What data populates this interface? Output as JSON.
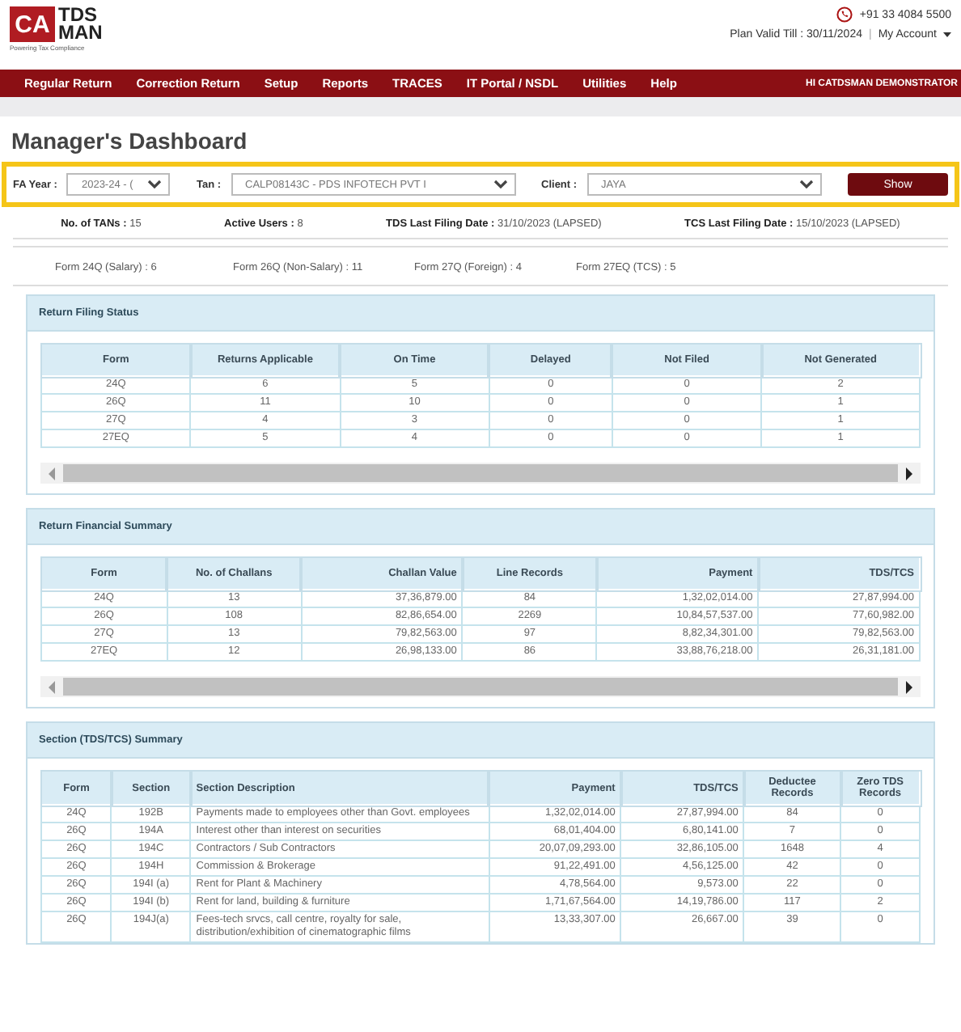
{
  "logo": {
    "mark": "CA",
    "line_1": "TDS",
    "line_2": "MAN",
    "tagline": "Powering Tax Compliance"
  },
  "header": {
    "phone": "+91 33 4084 5500",
    "plan_valid": "Plan Valid Till : 30/11/2024",
    "separator": "|",
    "account": "My Account"
  },
  "nav": {
    "items": [
      "Regular Return",
      "Correction Return",
      "Setup",
      "Reports",
      "TRACES",
      "IT Portal / NSDL",
      "Utilities",
      "Help"
    ],
    "user": "HI CATDSMAN DEMONSTRATOR"
  },
  "title": "Manager's Dashboard",
  "filters": [
    {
      "label": "FA Year :",
      "value": "2023-24 - ("
    },
    {
      "label": "Tan :",
      "value": "CALP08143C - PDS INFOTECH PVT I"
    },
    {
      "label": "Client :",
      "value": "JAYA"
    }
  ],
  "show_button": "Show",
  "stats": [
    {
      "label": "No. of TANs :",
      "value": "15"
    },
    {
      "label": "Active Users :",
      "value": "8"
    },
    {
      "label": "TDS Last Filing Date :",
      "value": "31/10/2023 (LAPSED)"
    },
    {
      "label": "TCS Last Filing Date :",
      "value": "15/10/2023 (LAPSED)"
    }
  ],
  "form_counts": [
    "Form 24Q (Salary) : 6",
    "Form 26Q (Non-Salary) : 11",
    "Form 27Q (Foreign) : 4",
    "Form 27EQ (TCS) : 5"
  ],
  "panels": [
    {
      "title": "Return Filing Status",
      "kind": "scroll",
      "columns": [
        "Form",
        "Returns Applicable",
        "On Time",
        "Delayed",
        "Not Filed",
        "Not Generated"
      ],
      "rows": [
        [
          "24Q",
          "6",
          "5",
          "0",
          "0",
          "2"
        ],
        [
          "26Q",
          "11",
          "10",
          "0",
          "0",
          "1"
        ],
        [
          "27Q",
          "4",
          "3",
          "0",
          "0",
          "1"
        ],
        [
          "27EQ",
          "5",
          "4",
          "0",
          "0",
          "1"
        ]
      ]
    },
    {
      "title": "Return Financial Summary",
      "kind": "scroll",
      "columns": [
        "Form",
        "No. of Challans",
        "Challan Value",
        "Line Records",
        "Payment",
        "TDS/TCS"
      ],
      "rows": [
        [
          "24Q",
          "13",
          "37,36,879.00",
          "84",
          "1,32,02,014.00",
          "27,87,994.00"
        ],
        [
          "26Q",
          "108",
          "82,86,654.00",
          "2269",
          "10,84,57,537.00",
          "77,60,982.00"
        ],
        [
          "27Q",
          "13",
          "79,82,563.00",
          "97",
          "8,82,34,301.00",
          "79,82,563.00"
        ],
        [
          "27EQ",
          "12",
          "26,98,133.00",
          "86",
          "33,88,76,218.00",
          "26,31,181.00"
        ]
      ]
    },
    {
      "title": "Section (TDS/TCS) Summary",
      "kind": "plain",
      "columns": [
        "Form",
        "Section",
        "Section Description",
        "Payment",
        "TDS/TCS",
        "Deductee Records",
        "Zero TDS Records"
      ],
      "rows": [
        [
          "24Q",
          "192B",
          "Payments made to employees other than Govt. employees",
          "1,32,02,014.00",
          "27,87,994.00",
          "84",
          "0"
        ],
        [
          "26Q",
          "194A",
          "Interest other than interest on securities",
          "68,01,404.00",
          "6,80,141.00",
          "7",
          "0"
        ],
        [
          "26Q",
          "194C",
          "Contractors / Sub Contractors",
          "20,07,09,293.00",
          "32,86,105.00",
          "1648",
          "4"
        ],
        [
          "26Q",
          "194H",
          "Commission & Brokerage",
          "91,22,491.00",
          "4,56,125.00",
          "42",
          "0"
        ],
        [
          "26Q",
          "194I (a)",
          "Rent for Plant & Machinery",
          "4,78,564.00",
          "9,573.00",
          "22",
          "0"
        ],
        [
          "26Q",
          "194I (b)",
          "Rent for land, building & furniture",
          "1,71,67,564.00",
          "14,19,786.00",
          "117",
          "2"
        ],
        [
          "26Q",
          "194J(a)",
          "Fees-tech srvcs, call centre, royalty for sale, distribution/exhibition of cinematographic films",
          "13,33,307.00",
          "26,667.00",
          "39",
          "0"
        ]
      ]
    }
  ]
}
